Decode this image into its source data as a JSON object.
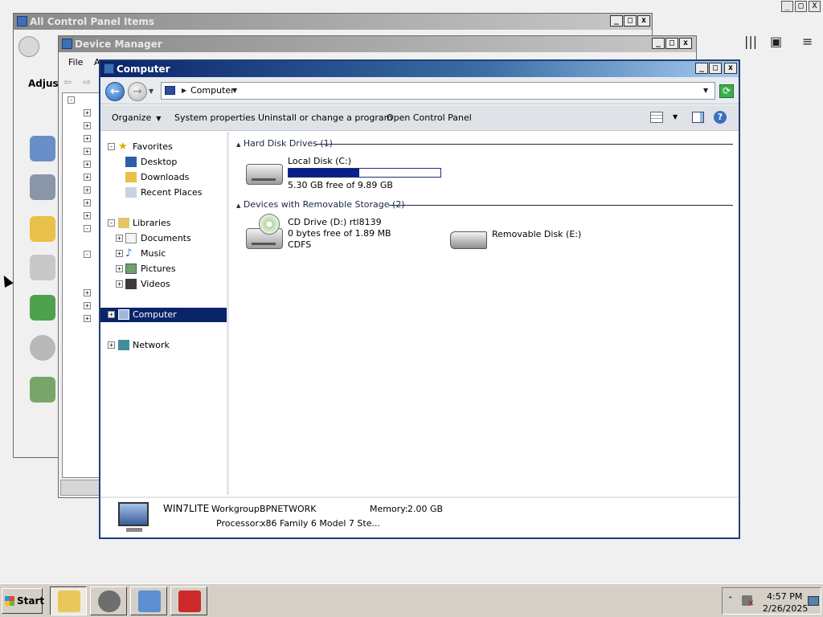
{
  "host": {
    "controls": [
      "_",
      "□",
      "X"
    ],
    "icons": [
      "library-icon",
      "sidebar-icon",
      "menu-icon"
    ]
  },
  "control_panel": {
    "title": "All Control Panel Items",
    "heading": "Adjust"
  },
  "device_manager": {
    "title": "Device Manager",
    "menu": [
      "File",
      "A"
    ]
  },
  "explorer": {
    "title": "Computer",
    "address": {
      "path": "Computer"
    },
    "commands": [
      "Organize",
      "System properties",
      "Uninstall or change a program",
      "Open Control Panel"
    ],
    "nav": {
      "favorites": "Favorites",
      "desktop": "Desktop",
      "downloads": "Downloads",
      "recent": "Recent Places",
      "libraries": "Libraries",
      "documents": "Documents",
      "music": "Music",
      "pictures": "Pictures",
      "videos": "Videos",
      "computer": "Computer",
      "network": "Network"
    },
    "groups": {
      "hdd": "Hard Disk Drives (1)",
      "removable": "Devices with Removable Storage (2)"
    },
    "drives": {
      "c": {
        "name": "Local Disk (C:)",
        "free": "5.30 GB free of 9.89 GB",
        "used_fraction": 0.464
      },
      "d": {
        "name": "CD Drive (D:) rtl8139",
        "free": "0 bytes free of 1.89 MB",
        "fs": "CDFS"
      },
      "e": {
        "name": "Removable Disk (E:)"
      }
    },
    "details": {
      "computer_name": "WIN7LITE",
      "workgroup_label": "Workgroup:",
      "workgroup": "BPNETWORK",
      "memory_label": "Memory:",
      "memory": "2.00 GB",
      "processor_label": "Processor:",
      "processor": "x86 Family 6 Model 7 Ste..."
    }
  },
  "taskbar": {
    "start": "Start",
    "time": "4:57 PM",
    "date": "2/26/2025"
  },
  "colors": {
    "selection": "#0a246a",
    "usage_bar": "#0a1d8a",
    "titlebar_active": "#0a246a"
  }
}
